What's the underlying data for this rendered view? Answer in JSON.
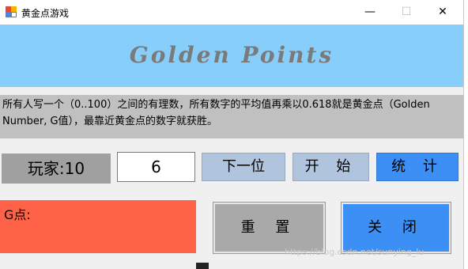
{
  "window": {
    "title": "黄金点游戏",
    "controls": {
      "minimize": "—",
      "maximize": "☐",
      "close": "✕"
    }
  },
  "header": {
    "logo_text": "Golden Points"
  },
  "rules": {
    "text": "所有人写一个（0..100）之间的有理数，所有数字的平均值再乘以0.618就是黄金点（Golden Number, G值），最靠近黄金点的数字就获胜。"
  },
  "controls": {
    "player_label": "玩家:10",
    "number_value": "6",
    "next_button": "下一位",
    "start_button": "开 始",
    "stats_button": "统 计"
  },
  "result": {
    "g_label": "G点:"
  },
  "actions": {
    "reset_button": "重 置",
    "close_button": "关 闭"
  },
  "watermark": {
    "text": "https://blog.csdn.net/sunying_lu"
  },
  "colors": {
    "header_bg": "#87cefa",
    "rules_bg": "#c0c0c0",
    "gpanel_bg": "#ff6347",
    "accent_blue": "#3c8ff5",
    "light_blue": "#b0c4de",
    "gray": "#a9a9a9"
  }
}
